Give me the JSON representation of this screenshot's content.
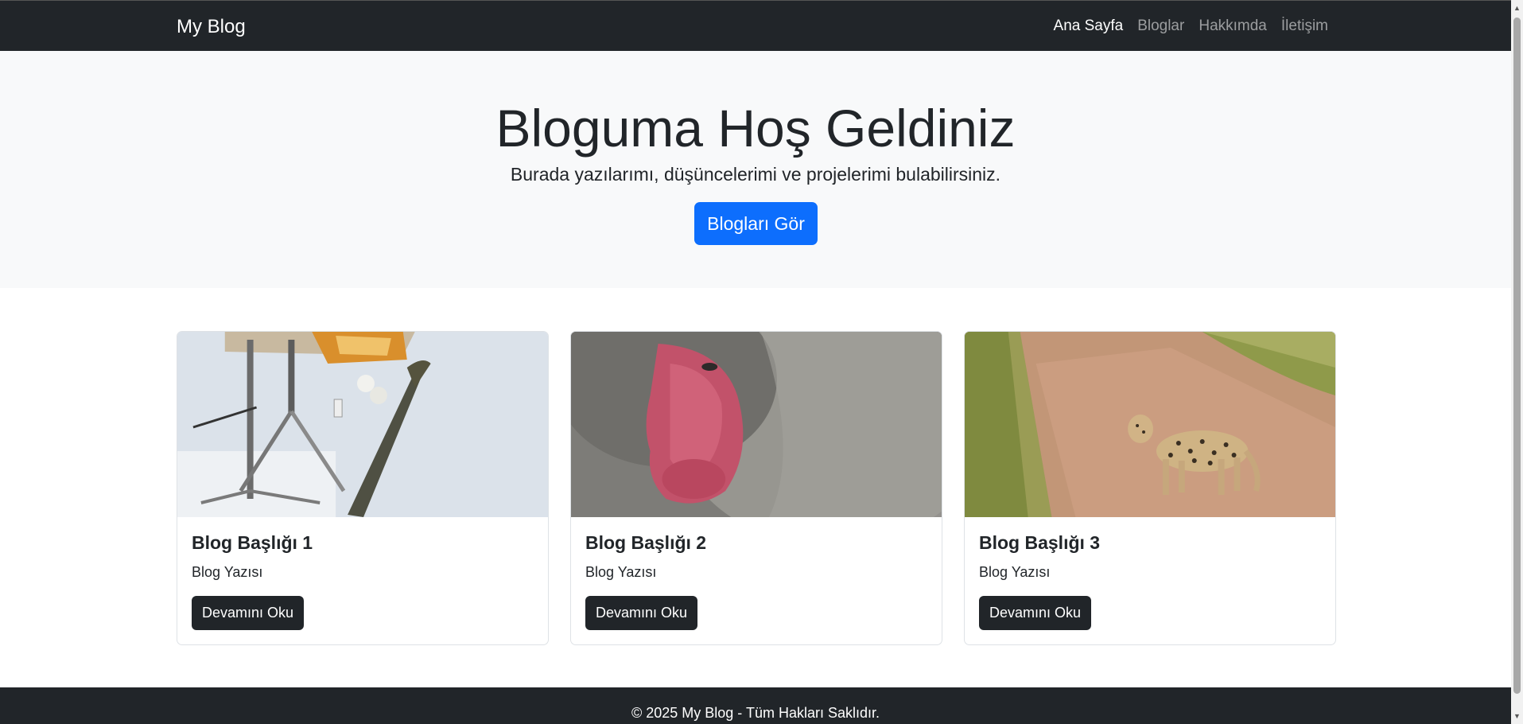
{
  "navbar": {
    "brand": "My Blog",
    "links": [
      {
        "label": "Ana Sayfa",
        "active": true
      },
      {
        "label": "Bloglar",
        "active": false
      },
      {
        "label": "Hakkımda",
        "active": false
      },
      {
        "label": "İletişim",
        "active": false
      }
    ]
  },
  "hero": {
    "title": "Bloguma Hoş Geldiniz",
    "subtitle": "Burada yazılarımı, düşüncelerimi ve projelerimi bulabilirsiniz.",
    "button_label": "Blogları Gör"
  },
  "cards": [
    {
      "title": "Blog Başlığı 1",
      "text": "Blog Yazısı",
      "button_label": "Devamını Oku",
      "image": "laboratory-equipment-photo"
    },
    {
      "title": "Blog Başlığı 2",
      "text": "Blog Yazısı",
      "button_label": "Devamını Oku",
      "image": "japanese-macaque-photo"
    },
    {
      "title": "Blog Başlığı 3",
      "text": "Blog Yazısı",
      "button_label": "Devamını Oku",
      "image": "leopard-on-dirt-road-photo"
    }
  ],
  "footer": {
    "text": "© 2025 My Blog - Tüm Hakları Saklıdır."
  },
  "colors": {
    "navbar_bg": "#212529",
    "hero_bg": "#f8f9fa",
    "primary": "#0d6efd",
    "dark_button": "#212529"
  }
}
